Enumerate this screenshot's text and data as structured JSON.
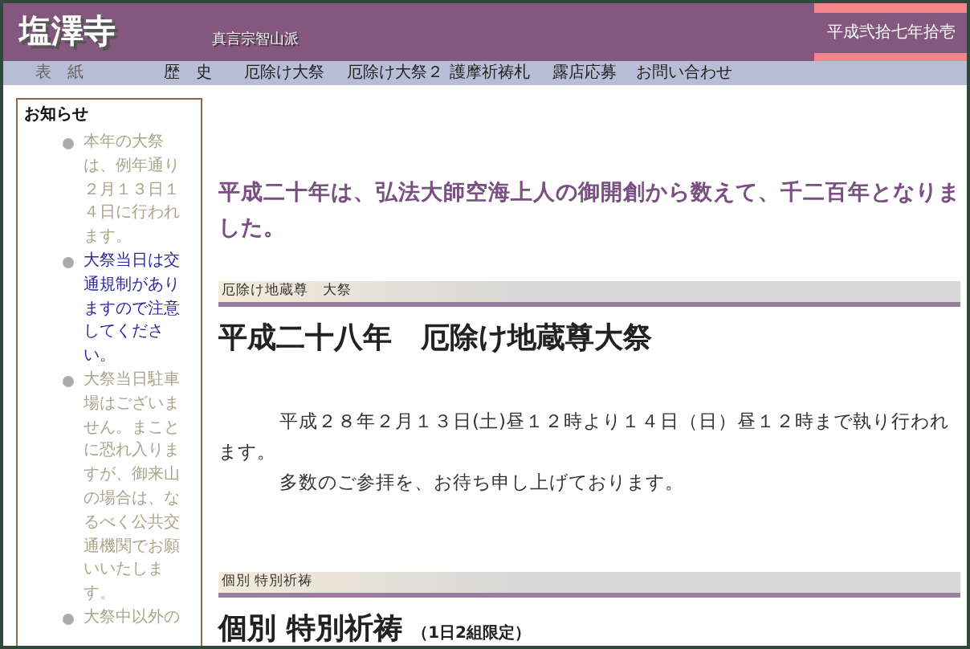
{
  "header": {
    "logo": "塩澤寺",
    "subtitle": "真言宗智山派",
    "date": "平成弐拾七年拾壱"
  },
  "nav": [
    {
      "label": "表　紙",
      "selected": true
    },
    {
      "label": "歴　史",
      "selected": false
    },
    {
      "label": "厄除け大祭",
      "selected": false
    },
    {
      "label": "厄除け大祭２",
      "selected": false
    },
    {
      "label": "護摩祈祷札",
      "selected": false
    },
    {
      "label": "露店応募",
      "selected": false
    },
    {
      "label": "お問い合わせ",
      "selected": false
    }
  ],
  "sidebar": {
    "title": "お知らせ",
    "items": [
      {
        "kind": "text",
        "text": "本年の大祭は、例年通り２月１３日１４日に行われます。"
      },
      {
        "kind": "link",
        "text": "大祭当日は交通規制がありますので注意してください。"
      },
      {
        "kind": "text",
        "text": "大祭当日駐車場はございません。まことに恐れ入りますが、御来山の場合は、なるべく公共交通機関でお願いいたします。"
      },
      {
        "kind": "text",
        "text": "大祭中以外の"
      }
    ]
  },
  "main": {
    "intro": "平成二十年は、弘法大師空海上人の御開創から数えて、千二百年となりました。",
    "sections": [
      {
        "label": "厄除け地蔵尊　大祭",
        "heading": "平成二十八年　厄除け地蔵尊大祭",
        "paragraphs": [
          "平成２８年２月１３日(土)昼１２時より１４日（日）昼１２時まで執り行われます。",
          "多数のご参拝を、お待ち申し上げております。"
        ]
      },
      {
        "label": "個別 特別祈祷",
        "heading": "個別 特別祈祷",
        "note": "（1日2組限定）"
      }
    ]
  }
}
